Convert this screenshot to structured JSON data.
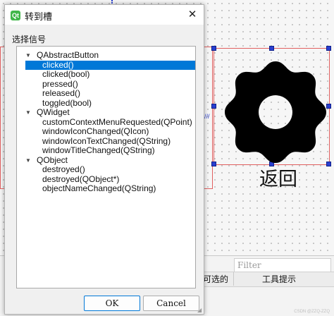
{
  "dialog": {
    "title": "转到槽",
    "close_glyph": "✕",
    "icon_text": "Qt",
    "group_label": "选择信号",
    "tree": [
      {
        "type": "group",
        "label": "QAbstractButton",
        "expanded": true
      },
      {
        "type": "item",
        "label": "clicked()",
        "selected": true
      },
      {
        "type": "item",
        "label": "clicked(bool)"
      },
      {
        "type": "item",
        "label": "pressed()"
      },
      {
        "type": "item",
        "label": "released()"
      },
      {
        "type": "item",
        "label": "toggled(bool)"
      },
      {
        "type": "group",
        "label": "QWidget",
        "expanded": true
      },
      {
        "type": "item",
        "label": "customContextMenuRequested(QPoint)"
      },
      {
        "type": "item",
        "label": "windowIconChanged(QIcon)"
      },
      {
        "type": "item",
        "label": "windowIconTextChanged(QString)"
      },
      {
        "type": "item",
        "label": "windowTitleChanged(QString)"
      },
      {
        "type": "group",
        "label": "QObject",
        "expanded": true
      },
      {
        "type": "item",
        "label": "destroyed()"
      },
      {
        "type": "item",
        "label": "destroyed(QObject*)"
      },
      {
        "type": "item",
        "label": "objectNameChanged(QString)"
      }
    ],
    "ok_label": "OK",
    "cancel_label": "Cancel"
  },
  "designer": {
    "button_text": "返回",
    "filter_placeholder": "Filter",
    "columns": [
      "可选的",
      "工具提示"
    ],
    "watermark": "CSDN @ZZQ-ZZQ"
  },
  "colors": {
    "selection": "#0078d7",
    "frame_red": "#e06060",
    "handle_blue": "#2a3fd0"
  }
}
